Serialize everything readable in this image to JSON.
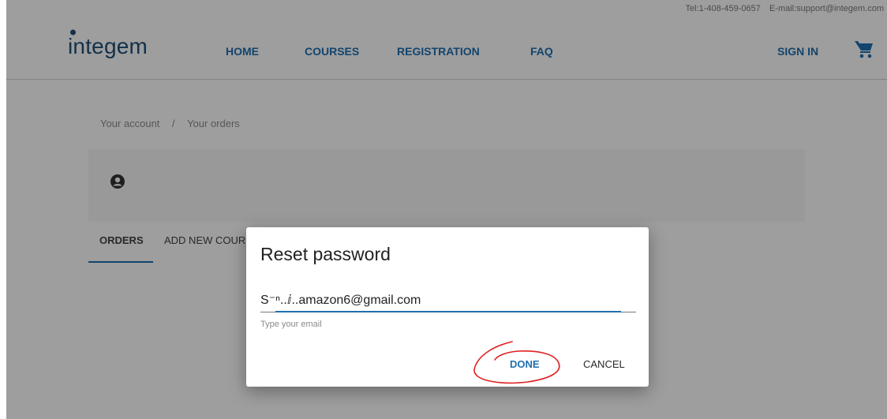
{
  "contact": {
    "phone": "Tel:1-408-459-0657",
    "email": "E-mail:support@integem.com"
  },
  "header": {
    "logo_text": "ntegem",
    "nav": [
      "HOME",
      "COURSES",
      "REGISTRATION",
      "FAQ"
    ],
    "sign_in": "SIGN IN"
  },
  "breadcrumb": {
    "items": [
      "Your account",
      "Your orders"
    ],
    "separator": "/"
  },
  "tabs": [
    "ORDERS",
    "ADD NEW COUR"
  ],
  "dialog": {
    "title": "Reset password",
    "email_value": "S⁻ⁿ..ⅈ..amazon6@gmail.com",
    "hint": "Type your email",
    "done_label": "DONE",
    "cancel_label": "CANCEL"
  },
  "colors": {
    "brand": "#1f4f78",
    "accent": "#1f6fb0",
    "annotation": "#e02020"
  },
  "icons": [
    "user-circle-icon",
    "cart-icon",
    "logo-person-icon"
  ]
}
